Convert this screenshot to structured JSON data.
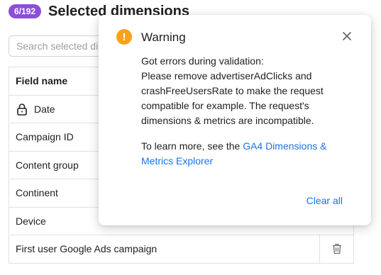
{
  "header": {
    "count": "6/192",
    "title": "Selected dimensions"
  },
  "search": {
    "placeholder": "Search selected dir"
  },
  "table": {
    "column_header": "Field name",
    "rows": [
      {
        "name": "Date",
        "locked": true
      },
      {
        "name": "Campaign ID"
      },
      {
        "name": "Content group"
      },
      {
        "name": "Continent"
      },
      {
        "name": "Device"
      },
      {
        "name": "First user Google Ads campaign"
      }
    ]
  },
  "dialog": {
    "title": "Warning",
    "message_line1": "Got errors during validation:",
    "message": "Please remove advertiserAdClicks and crashFreeUsersRate to make the request compatible for example. The request's dimensions & metrics are incompatible.",
    "learn_more_prefix": "To learn more, see the ",
    "learn_more_link": "GA4 Dimensions & Metrics Explorer",
    "clear_label": "Clear all"
  },
  "colors": {
    "badge": "#8a4fd6",
    "warning": "#f7a21a",
    "link": "#1a73e8"
  }
}
